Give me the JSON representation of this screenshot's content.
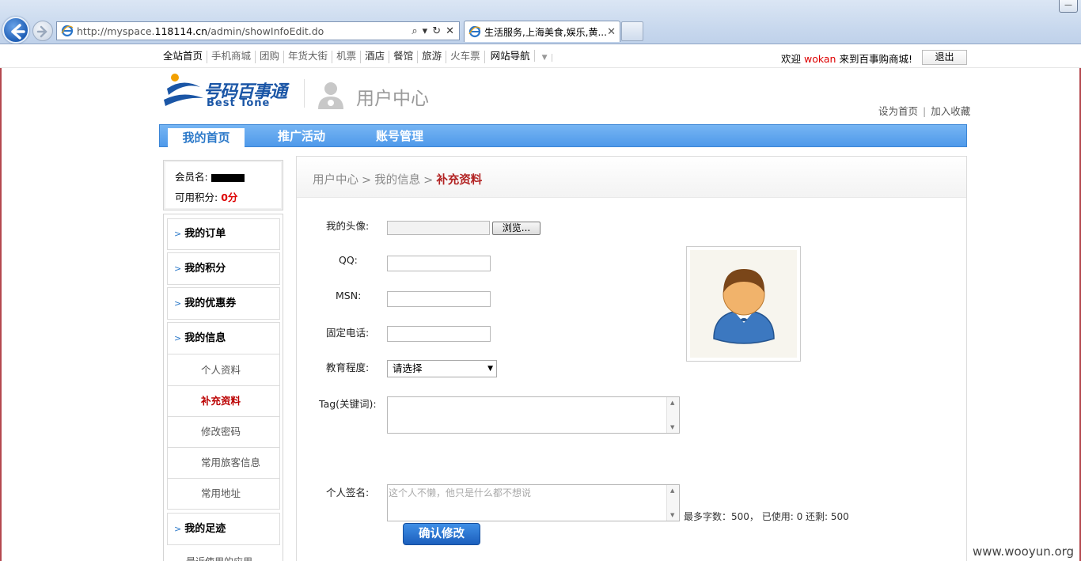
{
  "browser": {
    "url_prefix": "http://myspace.",
    "url_domain": "118114.cn",
    "url_path": "/admin/showInfoEdit.do",
    "tab_title": "生活服务,上海美食,娱乐,黄...",
    "close_glyph": "✕",
    "minimize_glyph": "—"
  },
  "topnav": {
    "items": [
      "全站首页",
      "手机商城",
      "团购",
      "年货大街",
      "机票",
      "酒店",
      "餐馆",
      "旅游",
      "火车票",
      "网站导航"
    ],
    "welcome_prefix": "欢迎 ",
    "username": "wokan",
    "welcome_suffix": " 来到百事购商城!",
    "logout": "退出"
  },
  "header": {
    "logo_cn": "号码百事通",
    "logo_en": "Best Tone",
    "title": "用户中心",
    "set_home": "设为首页",
    "separator": "|",
    "add_fav": "加入收藏"
  },
  "mainnav": {
    "items": [
      "我的首页",
      "推广活动",
      "账号管理"
    ]
  },
  "sidebar": {
    "member_label": "会员名:",
    "points_label": "可用积分:",
    "points_value": "0分",
    "arrow": ">",
    "items": [
      "我的订单",
      "我的积分",
      "我的优惠券",
      "我的信息"
    ],
    "subitems": [
      "个人资料",
      "补充资料",
      "修改密码",
      "常用旅客信息",
      "常用地址"
    ],
    "footprint": "我的足迹",
    "cutoff_text": "最近使用的应用"
  },
  "breadcrumb": {
    "home": "用户中心",
    "sep": ">",
    "mid": "我的信息",
    "current": "补充资料"
  },
  "form": {
    "avatar_label": "我的头像:",
    "browse": "浏览...",
    "qq_label": "QQ:",
    "msn_label": "MSN:",
    "phone_label": "固定电话:",
    "edu_label": "教育程度:",
    "edu_value": "请选择",
    "tag_label": "Tag(关键词):",
    "sign_label": "个人签名:",
    "sign_placeholder": "这个人不懒，他只是什么都不想说",
    "counter": "最多字数：500， 已使用: 0  还剩: 500",
    "submit": "确认修改"
  },
  "watermark": "www.wooyun.org",
  "colors": {
    "accent": "#4f9aea",
    "highlight_red": "#b22222"
  }
}
